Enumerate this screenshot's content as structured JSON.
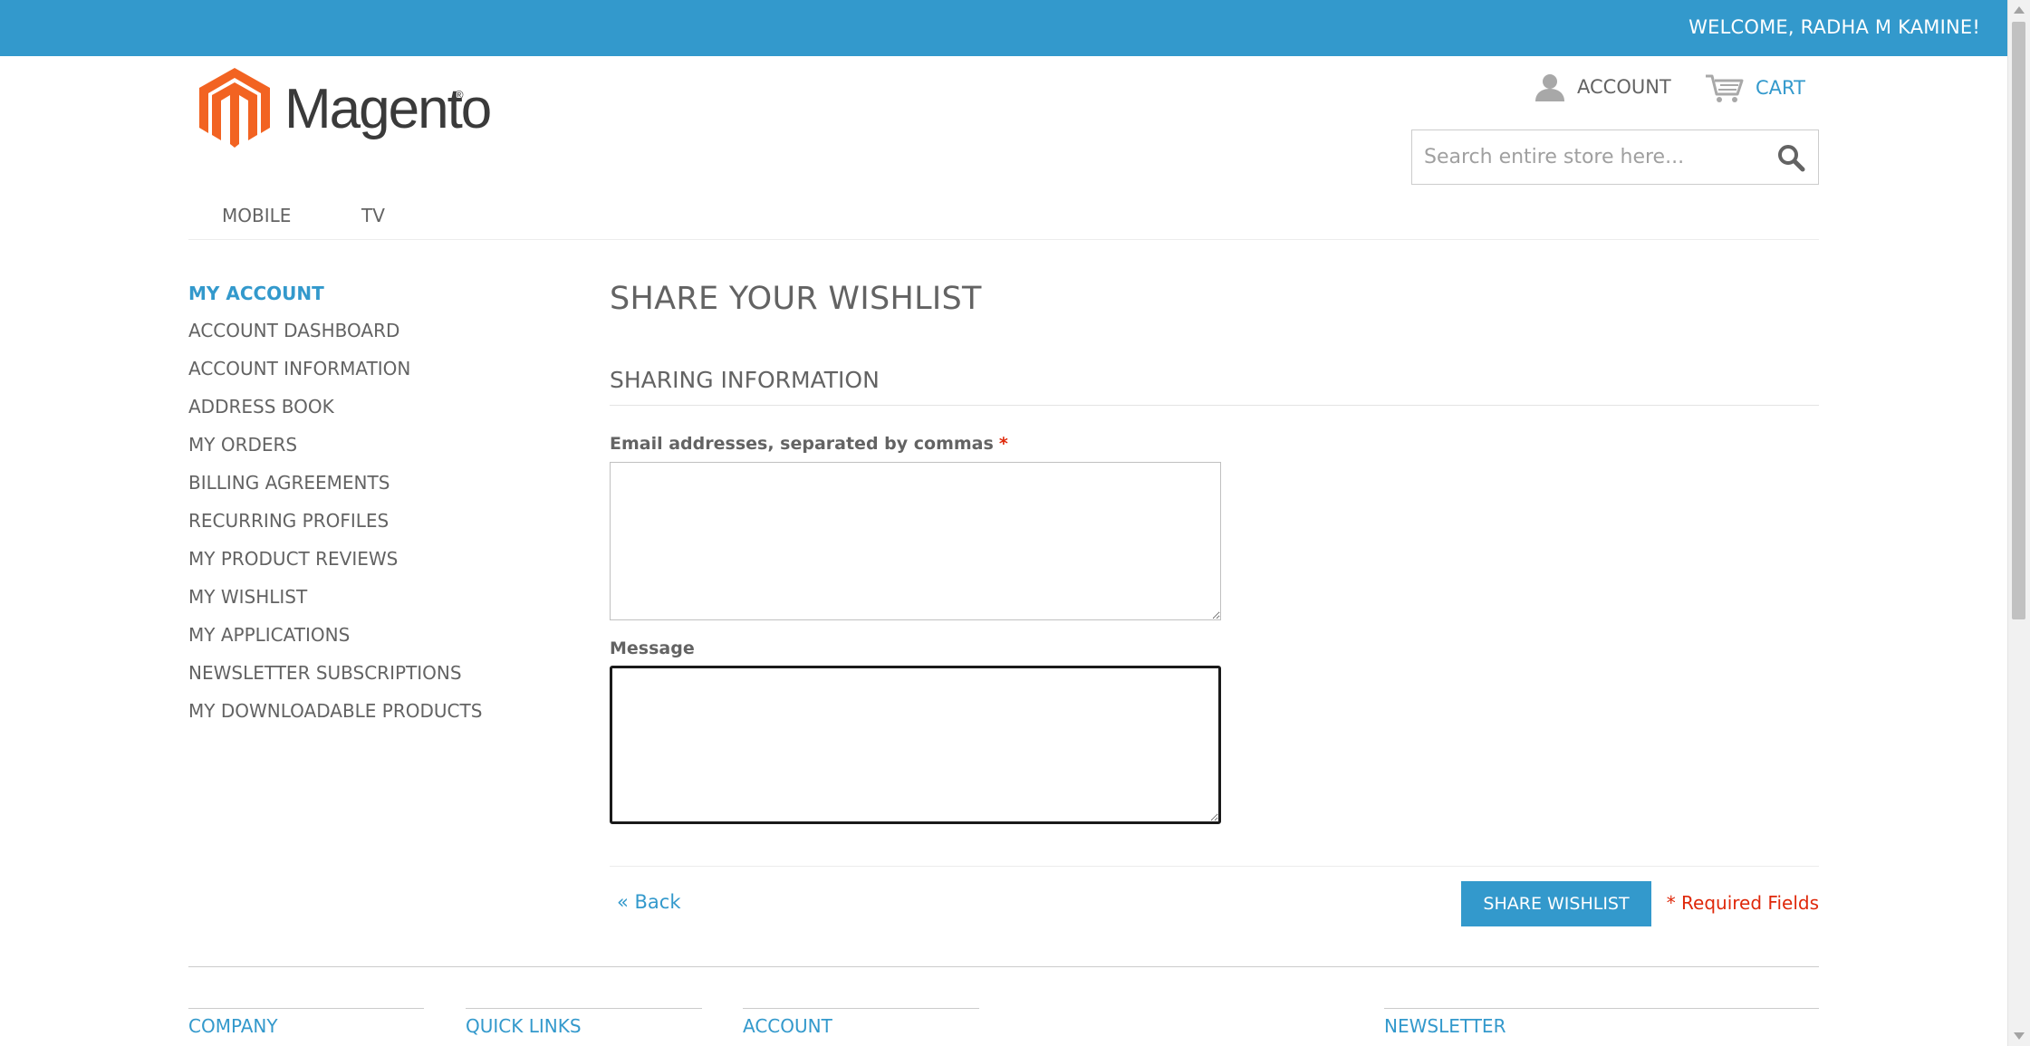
{
  "header": {
    "welcome": "WELCOME, RADHA M KAMINE!",
    "logo_text": "Magento",
    "logo_reg": "®",
    "account_label": "ACCOUNT",
    "cart_label": "CART",
    "search_placeholder": "Search entire store here..."
  },
  "nav": {
    "items": [
      "MOBILE",
      "TV"
    ]
  },
  "sidebar": {
    "title": "MY ACCOUNT",
    "items": [
      "ACCOUNT DASHBOARD",
      "ACCOUNT INFORMATION",
      "ADDRESS BOOK",
      "MY ORDERS",
      "BILLING AGREEMENTS",
      "RECURRING PROFILES",
      "MY PRODUCT REVIEWS",
      "MY WISHLIST",
      "MY APPLICATIONS",
      "NEWSLETTER SUBSCRIPTIONS",
      "MY DOWNLOADABLE PRODUCTS"
    ]
  },
  "main": {
    "page_title": "SHARE YOUR WISHLIST",
    "section_title": "SHARING INFORMATION",
    "email_label": "Email addresses, separated by commas",
    "required_star": "*",
    "email_value": "",
    "message_label": "Message",
    "message_value": "",
    "back_label": "« Back",
    "share_button_label": "SHARE WISHLIST",
    "required_note": "* Required Fields"
  },
  "footer": {
    "columns": [
      "COMPANY",
      "QUICK LINKS",
      "ACCOUNT",
      "NEWSLETTER"
    ]
  },
  "colors": {
    "accent": "#3399cc",
    "required": "#df280a",
    "logo_orange": "#f26322",
    "text": "#636363"
  },
  "icons": {
    "account": "user-icon",
    "cart": "cart-icon",
    "search": "search-icon"
  }
}
